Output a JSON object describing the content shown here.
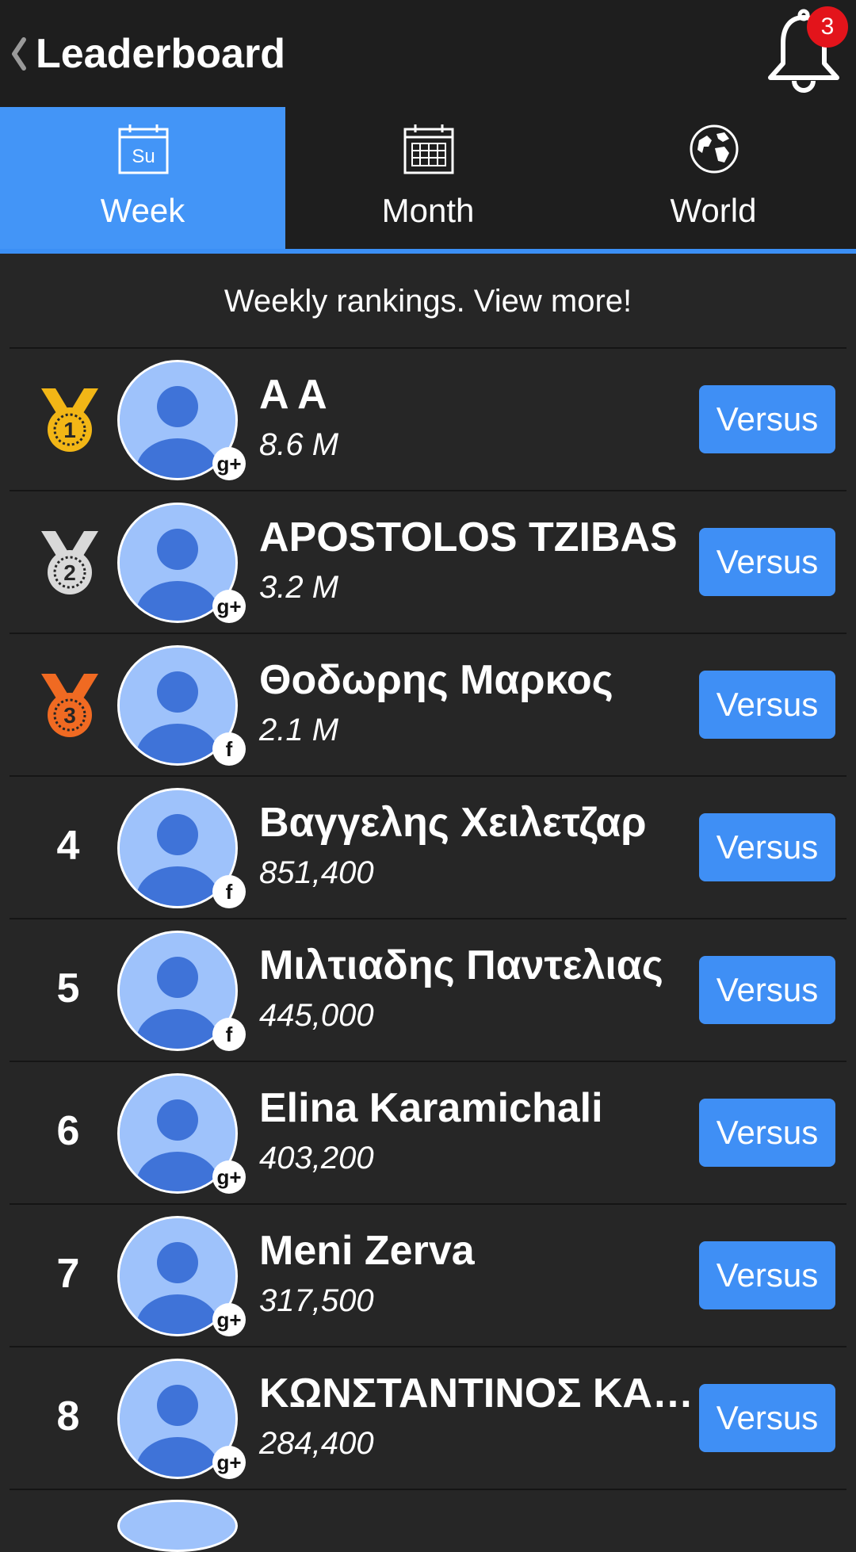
{
  "header": {
    "title": "Leaderboard",
    "notifications": "3"
  },
  "tabs": [
    {
      "label": "Week",
      "icon": "calendar-day-icon",
      "icon_text": "Su"
    },
    {
      "label": "Month",
      "icon": "calendar-grid-icon"
    },
    {
      "label": "World",
      "icon": "globe-icon"
    }
  ],
  "subtitle": "Weekly rankings. View more!",
  "versus_label": "Versus",
  "rows": [
    {
      "rank": "1",
      "medal": "gold",
      "name": "A A",
      "score": "8.6 M",
      "social": "g+"
    },
    {
      "rank": "2",
      "medal": "silver",
      "name": "APOSTOLOS TZIBAS",
      "score": "3.2 M",
      "social": "g+"
    },
    {
      "rank": "3",
      "medal": "bronze",
      "name": "Θοδωρης Μαρκος",
      "score": "2.1 M",
      "social": "f"
    },
    {
      "rank": "4",
      "name": "Βαγγελης Χειλετζαρ",
      "score": "851,400",
      "social": "f"
    },
    {
      "rank": "5",
      "name": "Μιλτιαδης Παντελιας",
      "score": "445,000",
      "social": "f"
    },
    {
      "rank": "6",
      "name": "Elina Karamichali",
      "score": "403,200",
      "social": "g+"
    },
    {
      "rank": "7",
      "name": "Meni Zerva",
      "score": "317,500",
      "social": "g+"
    },
    {
      "rank": "8",
      "name": "ΚΩΝΣΤΑΝΤΙΝΟΣ ΚΑΡΑ",
      "score": "284,400",
      "social": "g+"
    }
  ],
  "colors": {
    "accent": "#3f8ff5",
    "background": "#262626",
    "gold": "#f2b616",
    "silver": "#d9d9d9",
    "bronze": "#f06a22",
    "badge": "#e3141b"
  }
}
